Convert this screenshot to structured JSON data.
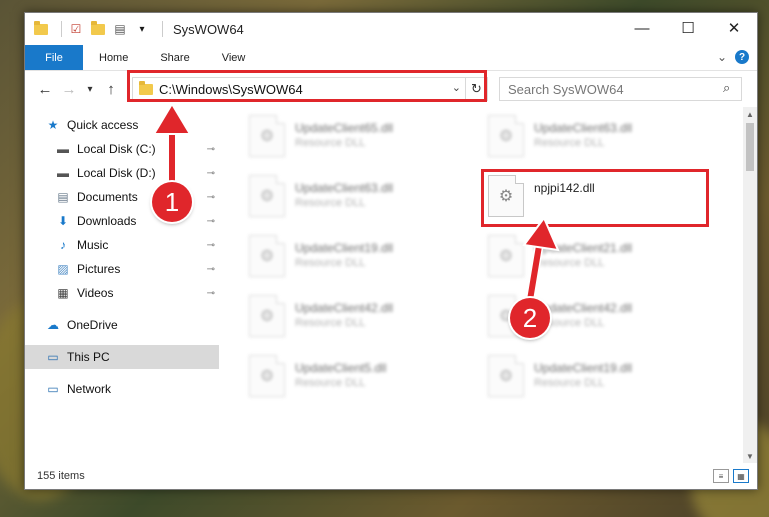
{
  "window": {
    "title": "SysWOW64",
    "caption": {
      "minimize": "—",
      "maximize": "☐",
      "close": "✕"
    }
  },
  "quick_access_toolbar": {
    "customize": "▾"
  },
  "ribbon": {
    "file_tab": "File",
    "tabs": [
      "Home",
      "Share",
      "View"
    ],
    "expand_glyph": "⌄",
    "help_glyph": "?"
  },
  "address": {
    "back": "←",
    "forward": "→",
    "recent": "▾",
    "up": "↑",
    "path": "C:\\Windows\\SysWOW64",
    "dropdown": "⌄",
    "refresh": "↻"
  },
  "search": {
    "placeholder": "Search SysWOW64",
    "icon": "⌕"
  },
  "nav": {
    "items": [
      {
        "label": "Quick access",
        "icon": "star-icon",
        "glyph": "★",
        "color": "#1979ca",
        "pinned": false
      },
      {
        "label": "Local Disk (C:)",
        "icon": "drive-icon",
        "glyph": "▬",
        "color": "#555555",
        "pinned": true
      },
      {
        "label": "Local Disk (D:)",
        "icon": "drive-icon",
        "glyph": "▬",
        "color": "#555555",
        "pinned": true
      },
      {
        "label": "Documents",
        "icon": "documents-icon",
        "glyph": "▤",
        "color": "#6a7b8c",
        "pinned": true
      },
      {
        "label": "Downloads",
        "icon": "download-icon",
        "glyph": "⬇",
        "color": "#1979ca",
        "pinned": true
      },
      {
        "label": "Music",
        "icon": "music-icon",
        "glyph": "♪",
        "color": "#1979ca",
        "pinned": true
      },
      {
        "label": "Pictures",
        "icon": "pictures-icon",
        "glyph": "▨",
        "color": "#4a8ac4",
        "pinned": true
      },
      {
        "label": "Videos",
        "icon": "video-icon",
        "glyph": "▦",
        "color": "#444444",
        "pinned": true
      },
      {
        "label": "OneDrive",
        "icon": "cloud-icon",
        "glyph": "☁",
        "color": "#1979ca",
        "pinned": false
      },
      {
        "label": "This PC",
        "icon": "computer-icon",
        "glyph": "▭",
        "color": "#2a6fb0",
        "pinned": false
      },
      {
        "label": "Network",
        "icon": "network-icon",
        "glyph": "▭",
        "color": "#2a6fb0",
        "pinned": false
      }
    ],
    "pin_glyph": "📌"
  },
  "files": [
    {
      "name": "UpdateClient65.dll",
      "type": "Resource DLL",
      "blurred": true
    },
    {
      "name": "UpdateClient63.dll",
      "type": "Resource DLL",
      "blurred": true
    },
    {
      "name": "UpdateClient63.dll",
      "type": "Resource DLL",
      "blurred": true
    },
    {
      "name": "npjpi142.dll",
      "type": "",
      "blurred": false
    },
    {
      "name": "UpdateClient19.dll",
      "type": "Resource DLL",
      "blurred": true
    },
    {
      "name": "UpdateClient21.dll",
      "type": "Resource DLL",
      "blurred": true
    },
    {
      "name": "UpdateClient42.dll",
      "type": "Resource DLL",
      "blurred": true
    },
    {
      "name": "UpdateClient42.dll",
      "type": "Resource DLL",
      "blurred": true
    },
    {
      "name": "UpdateClient5.dll",
      "type": "Resource DLL",
      "blurred": true
    },
    {
      "name": "UpdateClient19.dll",
      "type": "Resource DLL",
      "blurred": true
    }
  ],
  "file_icon_glyph": "⚙",
  "status": {
    "count": "155 items"
  },
  "annotations": {
    "step1": "1",
    "step2": "2",
    "accent_color": "#e0262b"
  },
  "colors": {
    "accent": "#1979ca",
    "highlight": "#e0262b"
  }
}
